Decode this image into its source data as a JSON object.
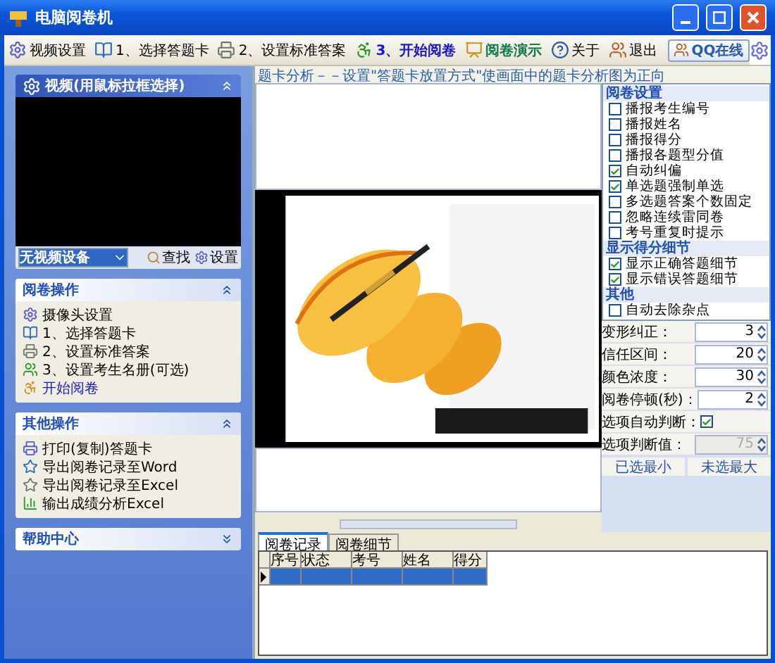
{
  "window": {
    "title": "电脑阅卷机"
  },
  "toolbar": {
    "items": [
      {
        "label": "视频设置",
        "color": "#000000"
      },
      {
        "label": "1、选择答题卡",
        "color": "#000000"
      },
      {
        "label": "2、设置标准答案",
        "color": "#000000"
      },
      {
        "label": "3、开始阅卷",
        "color": "#1a1acc"
      },
      {
        "label": "阅卷演示",
        "color": "#107a50"
      },
      {
        "label": "关于",
        "color": "#000000"
      },
      {
        "label": "退出",
        "color": "#000000"
      },
      {
        "label": "QQ在线",
        "color": "#2a5db0"
      }
    ]
  },
  "video_panel": {
    "title": "视频(用鼠标拉框选择)",
    "device": "无视频设备",
    "buttons": [
      "查找",
      "设置"
    ]
  },
  "panels": [
    {
      "title": "阅卷操作",
      "expanded": true,
      "items": [
        {
          "label": "摄像头设置",
          "color": "#000000"
        },
        {
          "label": "1、选择答题卡",
          "color": "#000000"
        },
        {
          "label": "2、设置标准答案",
          "color": "#000000"
        },
        {
          "label": "3、设置考生名册(可选)",
          "color": "#000000"
        },
        {
          "label": "开始阅卷",
          "color": "#1a1acc"
        }
      ]
    },
    {
      "title": "其他操作",
      "expanded": true,
      "items": [
        {
          "label": "打印(复制)答题卡",
          "color": "#000000"
        },
        {
          "label": "导出阅卷记录至Word",
          "color": "#000000"
        },
        {
          "label": "导出阅卷记录至Excel",
          "color": "#000000"
        },
        {
          "label": "输出成绩分析Excel",
          "color": "#000000"
        }
      ]
    },
    {
      "title": "帮助中心",
      "expanded": false
    }
  ],
  "caption": "题卡分析－－设置\"答题卡放置方式\"使画面中的题卡分析图为正向",
  "settings": {
    "sections": [
      {
        "title": "阅卷设置",
        "options": [
          {
            "label": "播报考生编号",
            "checked": false
          },
          {
            "label": "播报姓名",
            "checked": false
          },
          {
            "label": "播报得分",
            "checked": false
          },
          {
            "label": "播报各题型分值",
            "checked": false
          },
          {
            "label": "自动纠偏",
            "checked": true
          },
          {
            "label": "单选题强制单选",
            "checked": true
          },
          {
            "label": "多选题答案个数固定",
            "checked": false
          },
          {
            "label": "忽略连续雷同卷",
            "checked": false
          },
          {
            "label": "考号重复时提示",
            "checked": false
          }
        ]
      },
      {
        "title": "显示得分细节",
        "options": [
          {
            "label": "显示正确答题细节",
            "checked": true
          },
          {
            "label": "显示错误答题细节",
            "checked": true
          }
        ]
      },
      {
        "title": "其他",
        "options": [
          {
            "label": "自动去除杂点",
            "checked": false
          }
        ]
      }
    ],
    "fields": [
      {
        "kind": "spin",
        "label": "变形纠正：",
        "value": "3",
        "disabled": false
      },
      {
        "kind": "spin",
        "label": "信任区间：",
        "value": "20",
        "disabled": false
      },
      {
        "kind": "spin",
        "label": "颜色浓度：",
        "value": "30",
        "disabled": false
      },
      {
        "kind": "spin",
        "label": "阅卷停顿(秒)：",
        "value": "2",
        "disabled": false
      },
      {
        "kind": "check",
        "label": "选项自动判断：",
        "checked": true
      },
      {
        "kind": "spin",
        "label": "选项判断值：",
        "value": "75",
        "disabled": true
      }
    ],
    "buttons": [
      "已选最小",
      "未选最大"
    ]
  },
  "bottom": {
    "tabs": [
      {
        "label": "阅卷记录",
        "selected": true
      },
      {
        "label": "阅卷细节",
        "selected": false
      }
    ],
    "columns": [
      "序号",
      "状态",
      "考号",
      "姓名",
      "得分"
    ],
    "rows": [
      {
        "selected": true
      }
    ]
  }
}
